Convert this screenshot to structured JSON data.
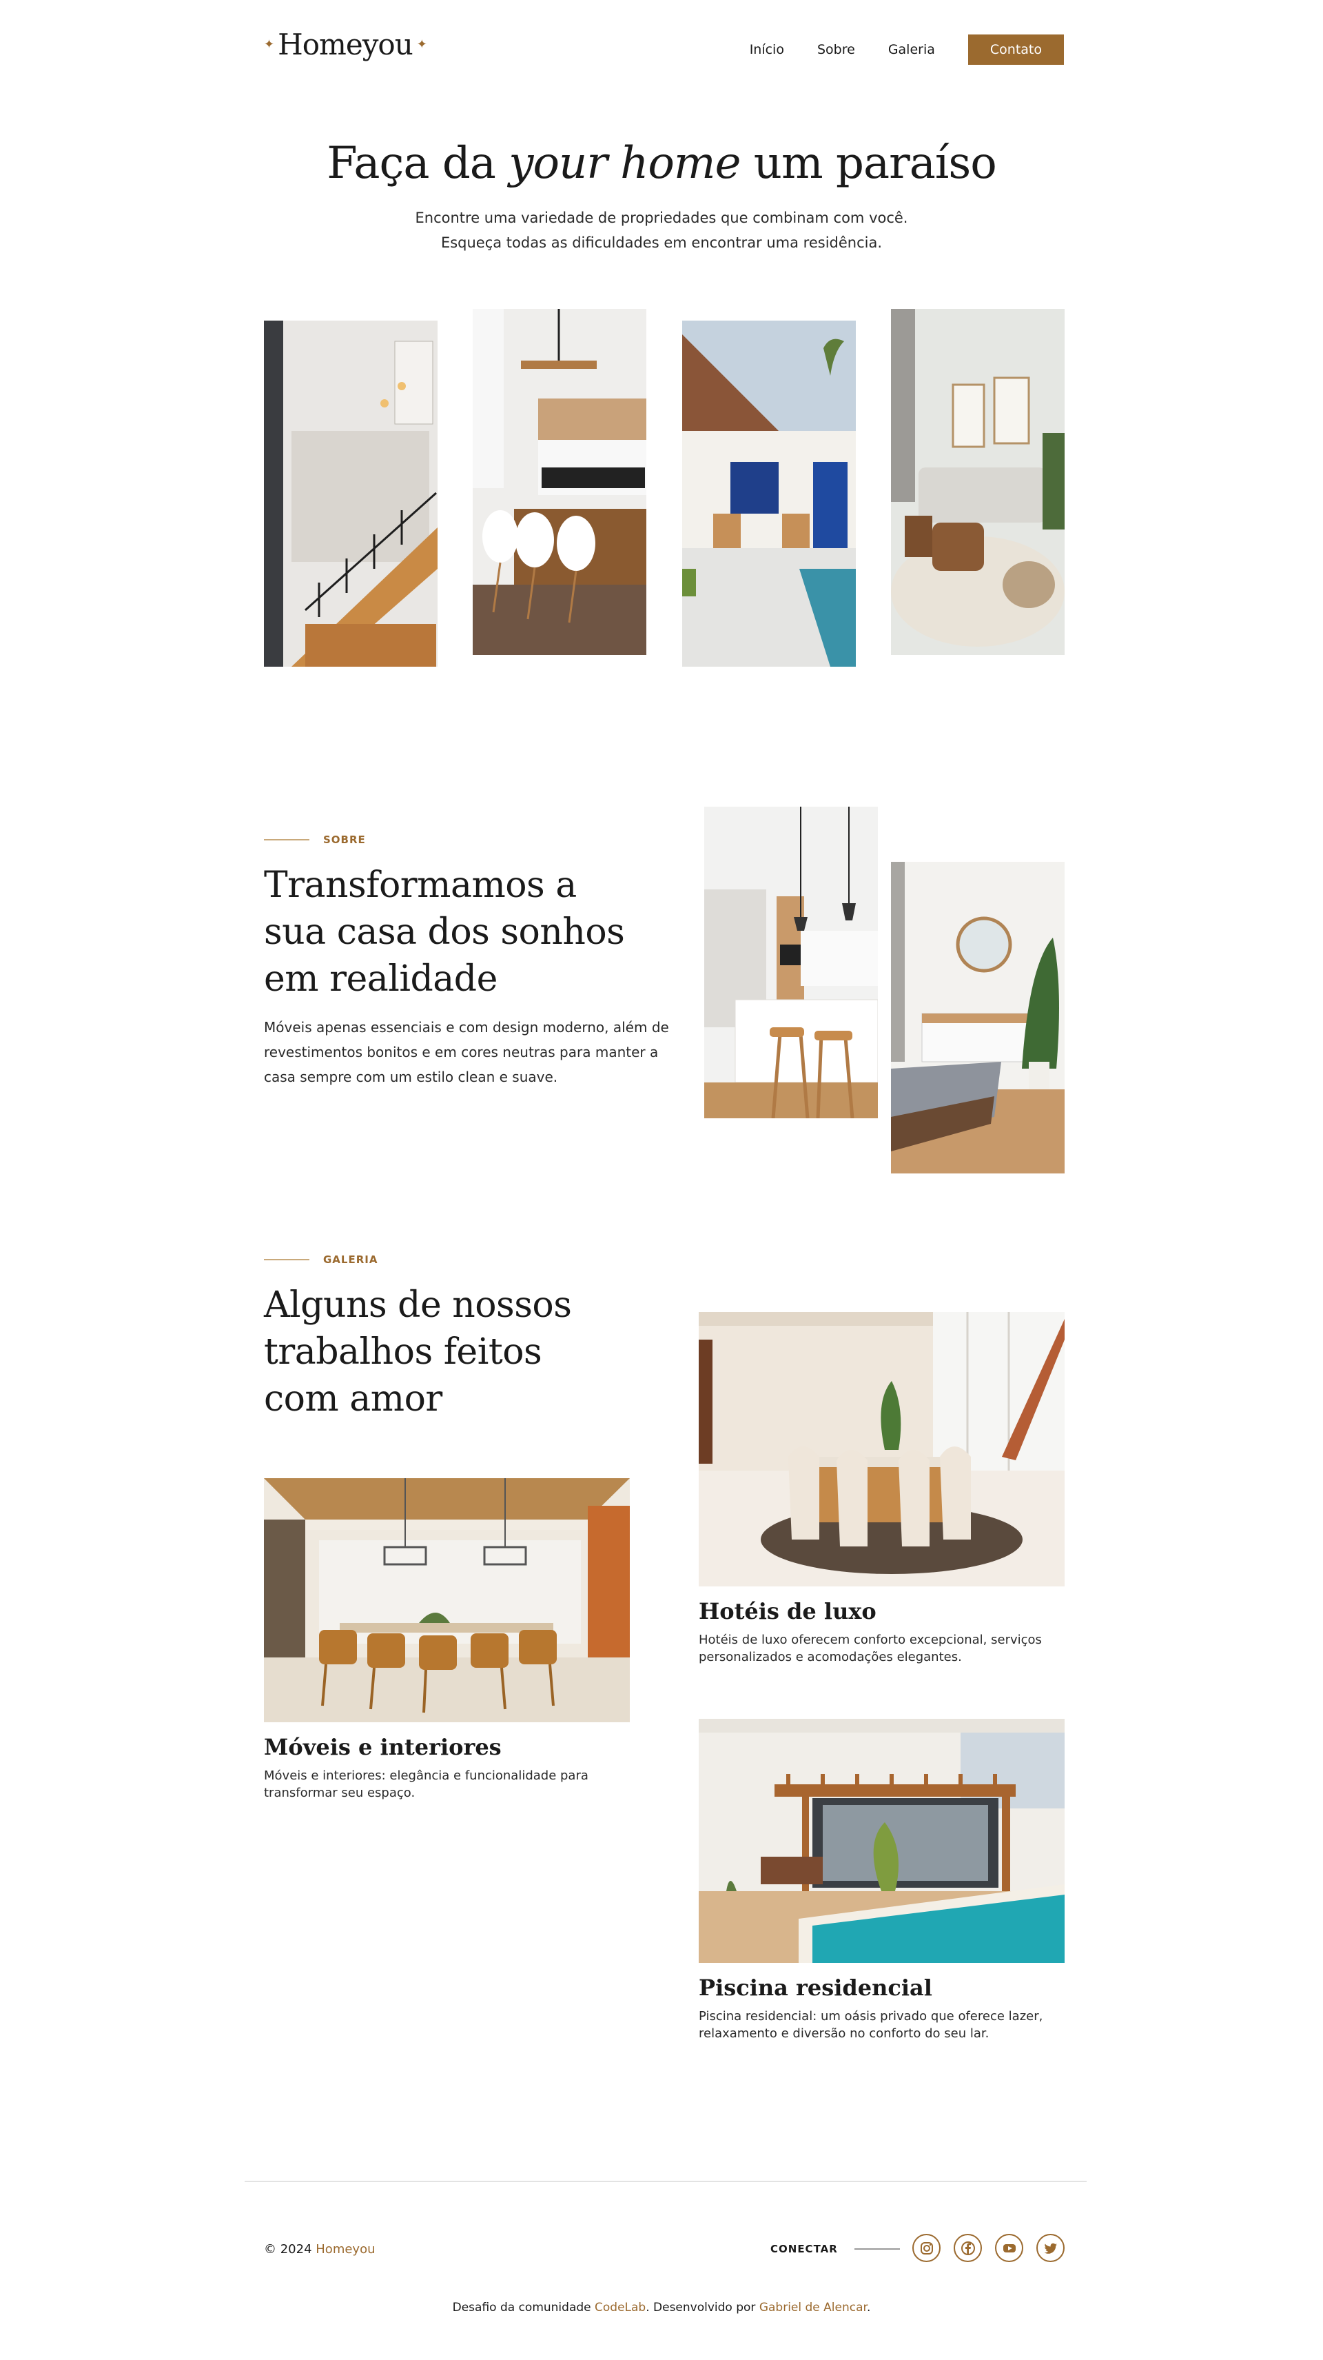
{
  "header": {
    "logo": "Homeyou",
    "nav": [
      "Início",
      "Sobre",
      "Galeria"
    ],
    "cta": "Contato"
  },
  "hero": {
    "title_start": "Faça da ",
    "title_italic": "your home",
    "title_end": " um paraíso",
    "subtitle_line1": "Encontre uma variedade de propriedades que combinam com você.",
    "subtitle_line2": "Esqueça todas as dificuldades em encontrar uma residência."
  },
  "about": {
    "eyebrow": "SOBRE",
    "title_line1": "Transformamos a",
    "title_line2": "sua casa dos sonhos",
    "title_line3": "em realidade",
    "text_line1": "Móveis apenas essenciais e com design moderno, além de",
    "text_line2": "revestimentos bonitos e em cores neutras para manter a",
    "text_line3": "casa sempre com um estilo clean e suave."
  },
  "gallery": {
    "eyebrow": "GALERIA",
    "title_line1": "Alguns de nossos",
    "title_line2": "trabalhos feitos",
    "title_line3": "com amor",
    "cards": [
      {
        "title": "Hotéis de luxo",
        "text_line1": "Hotéis de luxo oferecem conforto excepcional, serviços",
        "text_line2": "personalizados e acomodações elegantes."
      },
      {
        "title": "Móveis e interiores",
        "text_line1": "Móveis e interiores: elegância e funcionalidade para",
        "text_line2": "transformar seu espaço."
      },
      {
        "title": "Piscina residencial",
        "text_line1": "Piscina residencial: um oásis privado que oferece lazer,",
        "text_line2": "relaxamento e diversão no conforto do seu lar."
      }
    ]
  },
  "footer": {
    "copyright_prefix": "© 2024 ",
    "brand": "Homeyou",
    "connect": "CONECTAR",
    "socials": [
      "instagram-icon",
      "facebook-icon",
      "youtube-icon",
      "twitter-icon"
    ],
    "credits_prefix": "Desafio da comunidade ",
    "credits_community": "CodeLab",
    "credits_middle": ". Desenvolvido por ",
    "credits_author": "Gabriel de Alencar",
    "credits_suffix": "."
  },
  "colors": {
    "accent": "#9b6a2f",
    "text": "#1a1a1a",
    "background": "#ffffff"
  }
}
